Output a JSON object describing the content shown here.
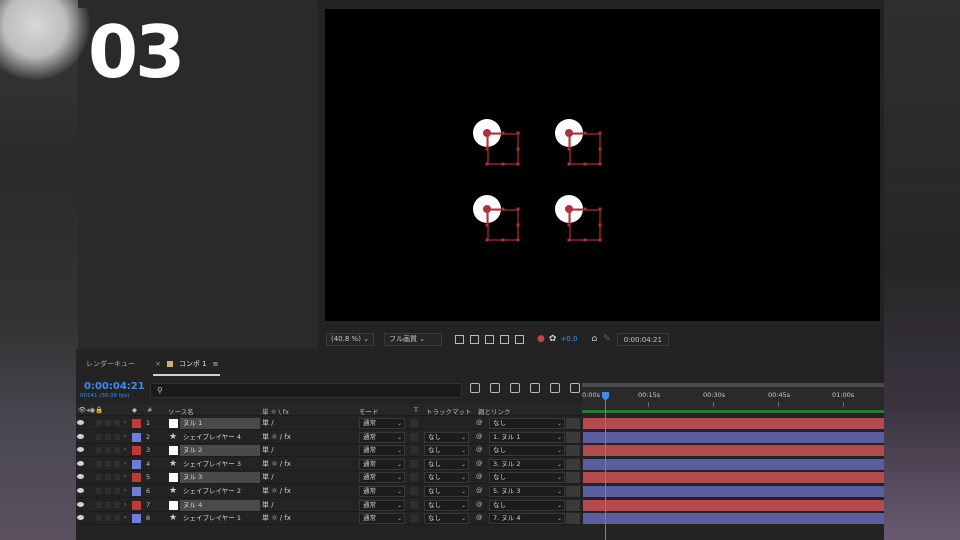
{
  "overlay": {
    "number": "03"
  },
  "viewer_bar": {
    "zoom": "(40.8 %)",
    "resolution": "フル画質",
    "exposure": "+0.0",
    "timecode": "0:00:04:21"
  },
  "tabs": [
    {
      "label": "レンダーキュー"
    },
    {
      "label": "コンポ 1"
    }
  ],
  "timeline": {
    "timecode": "0:00:04:21",
    "frame_info": "00141 (30.00 fps)",
    "search_icon": "search-icon",
    "ruler": [
      "0:00s",
      "00:15s",
      "00:30s",
      "00:45s",
      "01:00s"
    ]
  },
  "columns": {
    "hash": "#",
    "source": "ソース名",
    "switches": "単 ☼ \\ fx",
    "mode": "モード",
    "t": "T",
    "trackmatte": "トラックマット",
    "parent": "親とリンク"
  },
  "layers": [
    {
      "index": "1",
      "name": "ヌル 1",
      "type": "null",
      "label_color": "#c0393b",
      "switches": "単  /",
      "mode": "通常",
      "matte": "",
      "parent": "なし",
      "bar_color": "#b24a4e"
    },
    {
      "index": "2",
      "name": "シェイプレイヤー 4",
      "type": "shape",
      "label_color": "#6f7fd8",
      "switches": "単 ☼ / fx",
      "mode": "通常",
      "matte": "なし",
      "parent": "1. ヌル 1",
      "bar_color": "#5a5e9e"
    },
    {
      "index": "3",
      "name": "ヌル 2",
      "type": "null",
      "label_color": "#c0393b",
      "switches": "単  /",
      "mode": "通常",
      "matte": "なし",
      "parent": "なし",
      "bar_color": "#b24a4e"
    },
    {
      "index": "4",
      "name": "シェイプレイヤー 3",
      "type": "shape",
      "label_color": "#6f7fd8",
      "switches": "単 ☼ / fx",
      "mode": "通常",
      "matte": "なし",
      "parent": "3. ヌル 2",
      "bar_color": "#5a5e9e"
    },
    {
      "index": "5",
      "name": "ヌル 3",
      "type": "null",
      "label_color": "#c0393b",
      "switches": "単  /",
      "mode": "通常",
      "matte": "なし",
      "parent": "なし",
      "bar_color": "#b24a4e"
    },
    {
      "index": "6",
      "name": "シェイプレイヤー 2",
      "type": "shape",
      "label_color": "#6f7fd8",
      "switches": "単 ☼ / fx",
      "mode": "通常",
      "matte": "なし",
      "parent": "5. ヌル 3",
      "bar_color": "#5a5e9e"
    },
    {
      "index": "7",
      "name": "ヌル 4",
      "type": "null",
      "label_color": "#c0393b",
      "switches": "単  /",
      "mode": "通常",
      "matte": "なし",
      "parent": "なし",
      "bar_color": "#b24a4e"
    },
    {
      "index": "8",
      "name": "シェイプレイヤー 1",
      "type": "shape",
      "label_color": "#6f7fd8",
      "switches": "単 ☼ / fx",
      "mode": "通常",
      "matte": "なし",
      "parent": "7. ヌル 4",
      "bar_color": "#5a5e9e"
    }
  ]
}
